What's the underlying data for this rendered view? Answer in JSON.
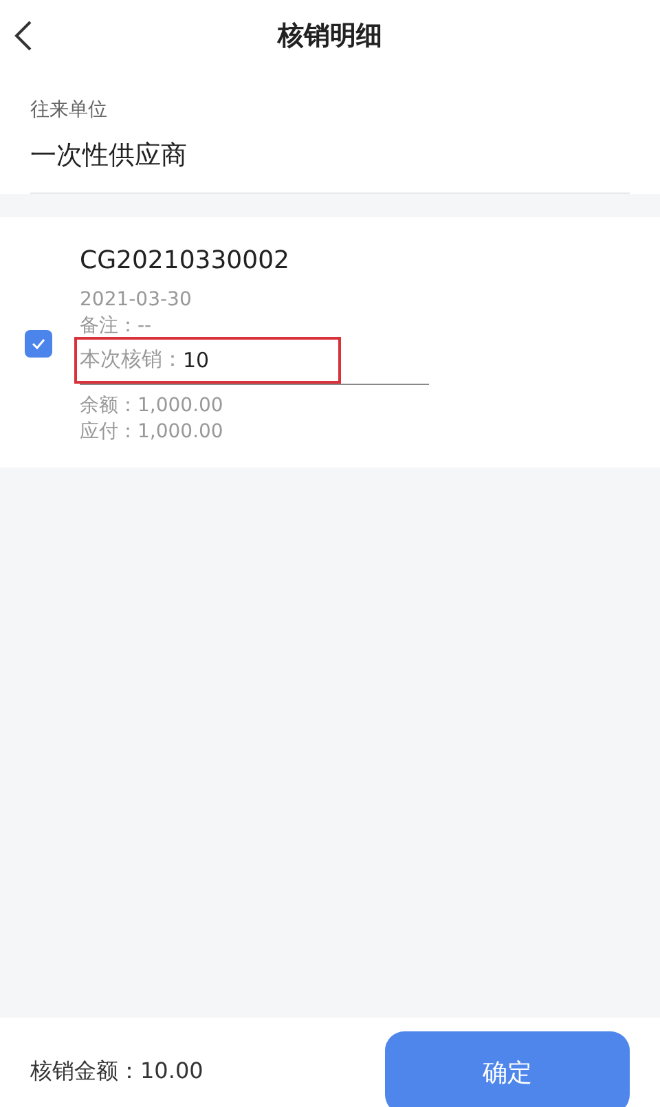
{
  "header": {
    "title": "核销明细"
  },
  "partner": {
    "label": "往来单位",
    "value": "一次性供应商"
  },
  "records": [
    {
      "checked": true,
      "code": "CG20210330002",
      "date": "2021-03-30",
      "note": "备注：--",
      "writeoff_label": "本次核销：",
      "writeoff_value": "10",
      "highlighted": true,
      "balance": "余额：1,000.00",
      "payable": "应付：1,000.00"
    }
  ],
  "footer": {
    "total": "核销金额：10.00",
    "confirm": "确定"
  }
}
